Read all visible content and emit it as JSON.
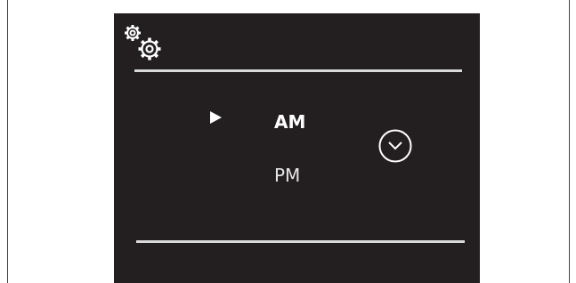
{
  "screen": {
    "settings_icon": "settings-gears-icon",
    "selection_icon": "play-arrow-icon",
    "options": [
      {
        "label": "AM",
        "selected": true
      },
      {
        "label": "PM",
        "selected": false
      }
    ],
    "clock_icon": "clock-icon"
  },
  "colors": {
    "page_background": "#ffffff",
    "screen_background": "#231f20",
    "foreground": "#ffffff",
    "divider": "#d9d9d9"
  }
}
